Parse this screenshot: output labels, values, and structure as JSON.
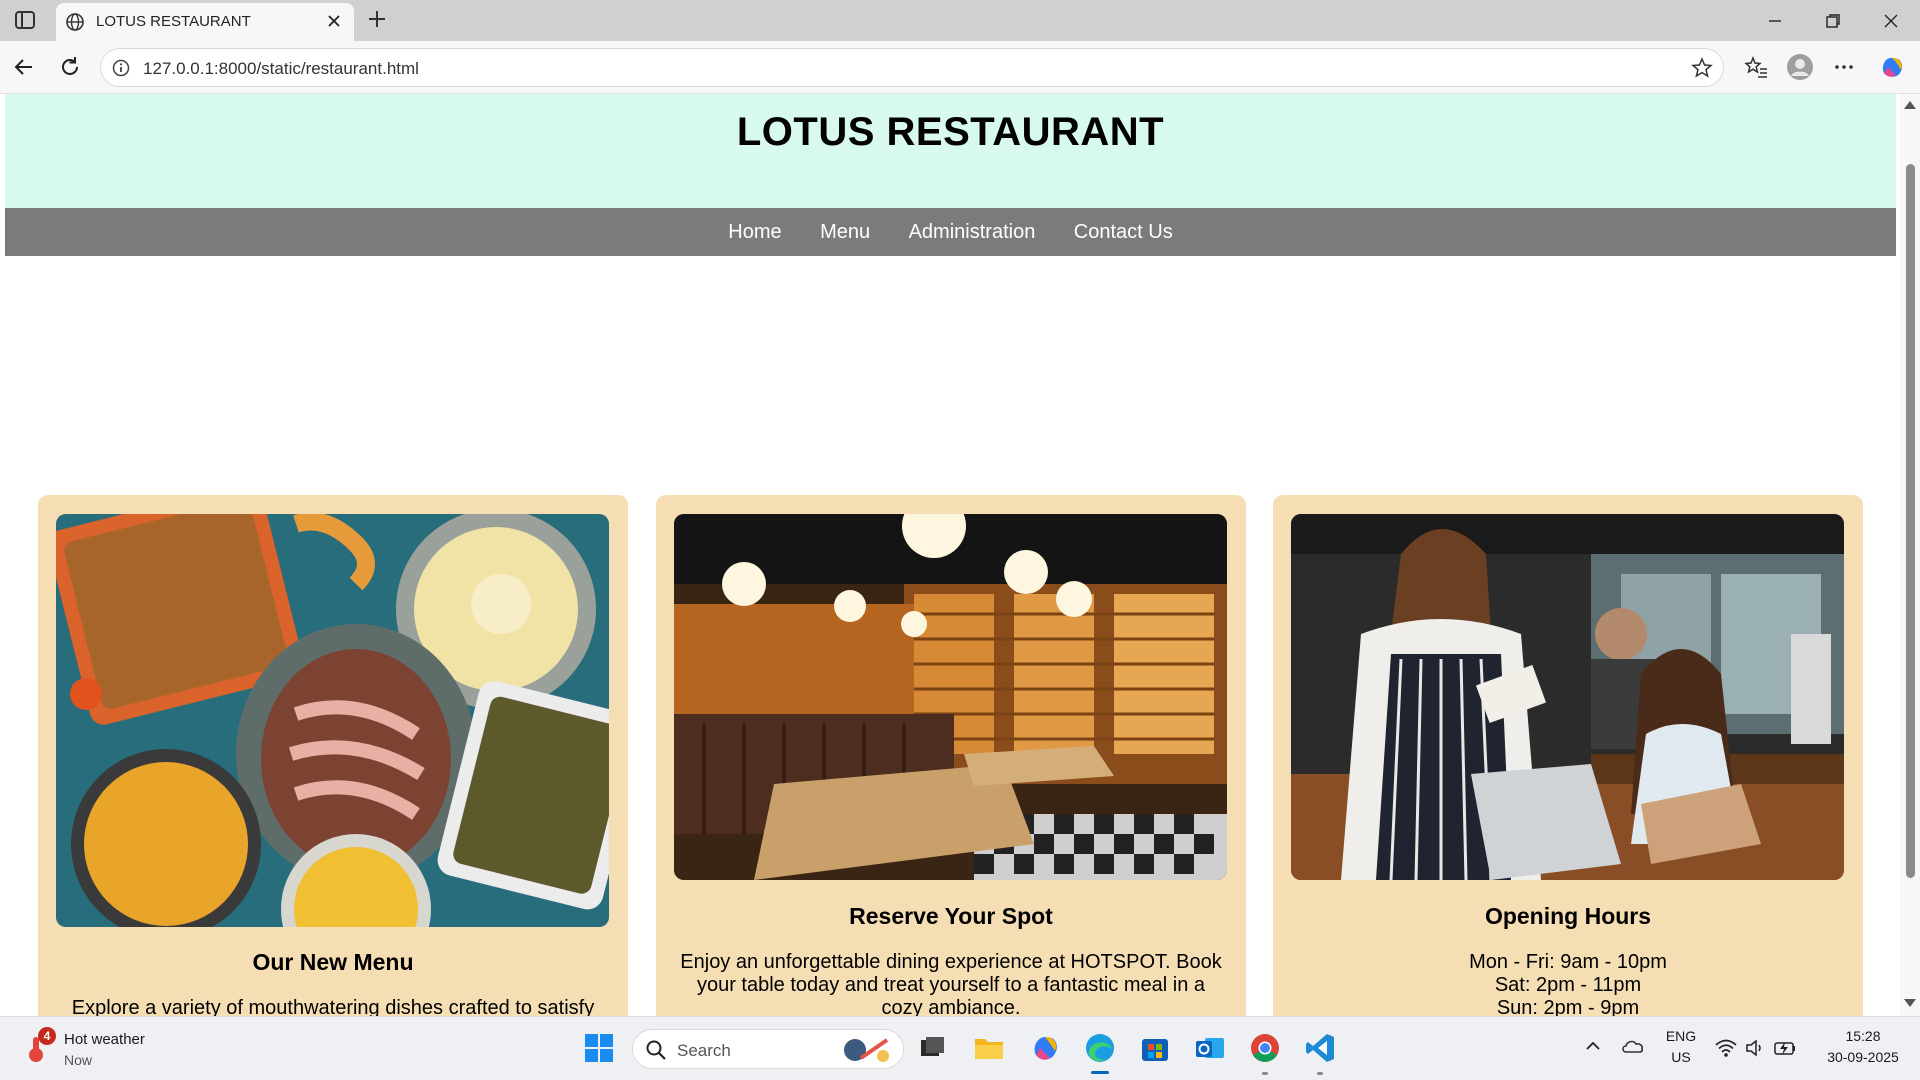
{
  "browser": {
    "tab_title": "LOTUS RESTAURANT",
    "url": "127.0.0.1:8000/static/restaurant.html"
  },
  "site": {
    "title": "LOTUS RESTAURANT",
    "nav": [
      "Home",
      "Menu",
      "Administration",
      "Contact Us"
    ],
    "colors": {
      "header_bg": "#d8f9ef",
      "nav_bg": "#7b7b7b",
      "card_bg": "#f5deb3"
    }
  },
  "cards": [
    {
      "title": "Our New Menu",
      "image": "food-spread-photo",
      "text": "Explore a variety of mouthwatering dishes crafted to satisfy"
    },
    {
      "title": "Reserve Your Spot",
      "image": "restaurant-interior-photo",
      "text": "Enjoy an unforgettable dining experience at HOTSPOT. Book your table today and treat yourself to a fantastic meal in a cozy ambiance."
    },
    {
      "title": "Opening Hours",
      "image": "waitress-taking-order-photo",
      "hours": [
        "Mon - Fri: 9am - 10pm",
        "Sat: 2pm - 11pm",
        "Sun: 2pm - 9pm"
      ]
    }
  ],
  "taskbar": {
    "weather_badge": "4",
    "weather_title": "Hot weather",
    "weather_sub": "Now",
    "search_placeholder": "Search",
    "lang_top": "ENG",
    "lang_bottom": "US",
    "time": "15:28",
    "date": "30-09-2025",
    "apps": [
      "windows-start-icon",
      "task-view-icon",
      "file-explorer-icon",
      "copilot-icon",
      "edge-icon",
      "microsoft-store-icon",
      "outlook-icon",
      "chrome-icon",
      "vscode-icon"
    ]
  }
}
